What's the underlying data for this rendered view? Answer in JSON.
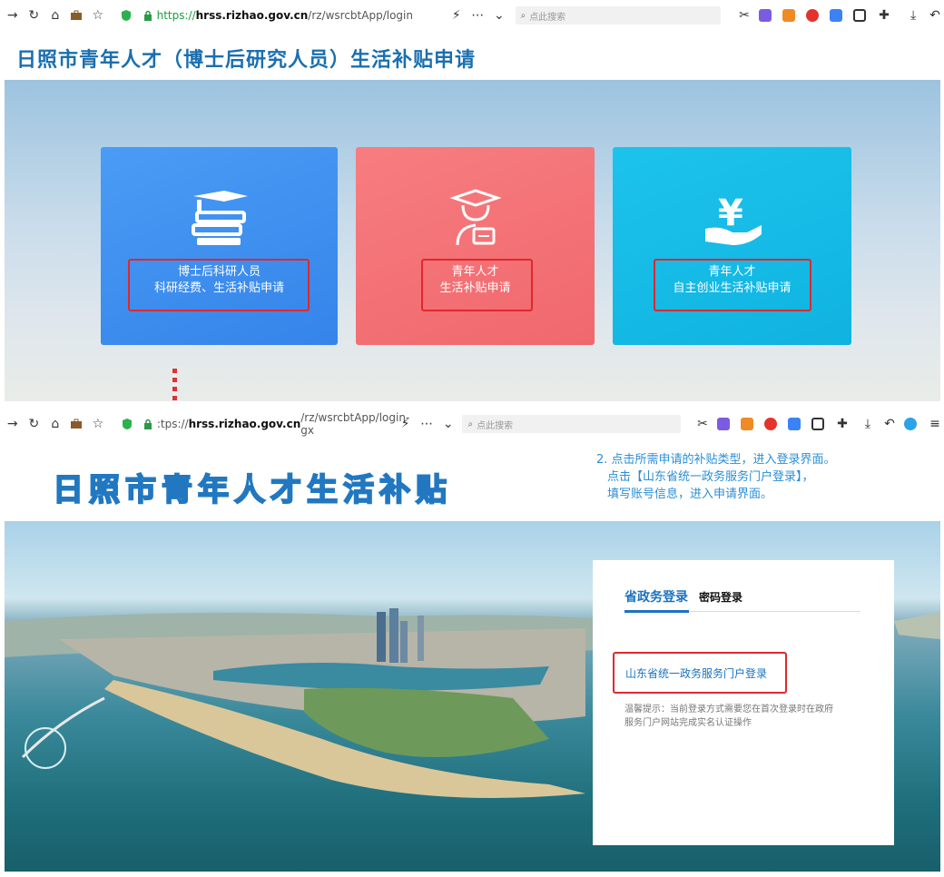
{
  "browser1": {
    "url_scheme": "https://",
    "url_host": "hrss.rizhao.gov.cn",
    "url_path": "/rz/wsrcbtApp/login",
    "search_placeholder": "点此搜索"
  },
  "page1": {
    "title": "日照市青年人才（博士后研究人员）生活补贴申请",
    "cards": [
      {
        "line1": "博士后科研人员",
        "line2": "科研经费、生活补贴申请",
        "color": "#3d8ff0"
      },
      {
        "line1": "青年人才",
        "line2": "生活补贴申请",
        "color": "#f56f73"
      },
      {
        "line1": "青年人才",
        "line2": "自主创业生活补贴申请",
        "color": "#16b8e4"
      }
    ]
  },
  "browser2": {
    "url_scheme": ":tps://",
    "url_host": "hrss.rizhao.gov.cn",
    "url_path": "/rz/wsrcbtApp/login-gx",
    "search_placeholder": "点此搜索"
  },
  "page2": {
    "title": "日照市青年人才生活补贴",
    "hint_lines": [
      "2. 点击所需申请的补贴类型，进入登录界面。",
      "点击【山东省统一政务服务门户登录】，",
      "填写账号信息，进入申请界面。"
    ],
    "login": {
      "tab_active": "省政务登录",
      "tab_other": "密码登录",
      "portal_link": "山东省统一政务服务门户登录",
      "tip_line1": "温馨提示：当前登录方式需要您在首次登录时在政府",
      "tip_line2": "服务门户网站完成实名认证操作"
    }
  },
  "colors": {
    "accent_blue": "#1a73c0",
    "highlight_red": "#e0282e"
  }
}
